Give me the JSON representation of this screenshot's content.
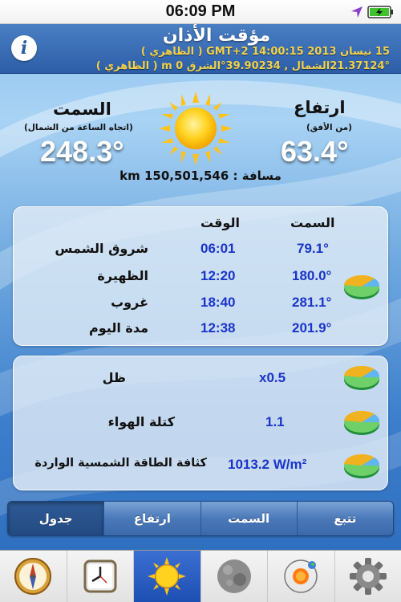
{
  "status": {
    "time": "06:09 PM"
  },
  "header": {
    "title": "مؤقت الأذان",
    "line1": "15 نيسان 2013  14:00:15  GMT+2  ( الظاهري )",
    "line2": "21.37124°الشمال , 39.90234°الشرق  0  m  ( الظاهري )"
  },
  "sun_position": {
    "azimuth_label": "السمت",
    "azimuth_sub": "(اتجاه الساعة من الشمال)",
    "azimuth_value": "248.3°",
    "altitude_label": "ارتفاع",
    "altitude_sub": "(من الأفق)",
    "altitude_value": "63.4°",
    "distance_text": "مسافة : 150,501,546 km"
  },
  "sun_table": {
    "col_time": "الوقت",
    "col_azimuth": "السمت",
    "rows": [
      {
        "label": "شروق الشمس",
        "time": "06:01",
        "azimuth": "79.1°"
      },
      {
        "label": "الظهيرة",
        "time": "12:20",
        "azimuth": "180.0°"
      },
      {
        "label": "غروب",
        "time": "18:40",
        "azimuth": "281.1°"
      },
      {
        "label": "مدة اليوم",
        "time": "12:38",
        "azimuth": "201.9°"
      }
    ]
  },
  "sun_extra": {
    "rows": [
      {
        "label": "ظل",
        "value": "x0.5"
      },
      {
        "label": "كتلة الهواء",
        "value": "1.1"
      },
      {
        "label": "كثافة الطاقة الشمسية الواردة",
        "value": "1013.2 W/m²"
      }
    ]
  },
  "segments": [
    {
      "label": "تتبع"
    },
    {
      "label": "السمت"
    },
    {
      "label": "ارتفاع"
    },
    {
      "label": "جدول",
      "selected": true
    }
  ],
  "tabs": [
    {
      "icon": "compass-icon"
    },
    {
      "icon": "clock-icon"
    },
    {
      "icon": "sun-icon",
      "selected": true
    },
    {
      "icon": "moon-icon"
    },
    {
      "icon": "solar-system-icon"
    },
    {
      "icon": "settings-gear-icon"
    }
  ],
  "colors": {
    "value_blue": "#1a34c8",
    "header_yellow": "#f3d24b",
    "tab_selected": "#1e4fb2"
  }
}
